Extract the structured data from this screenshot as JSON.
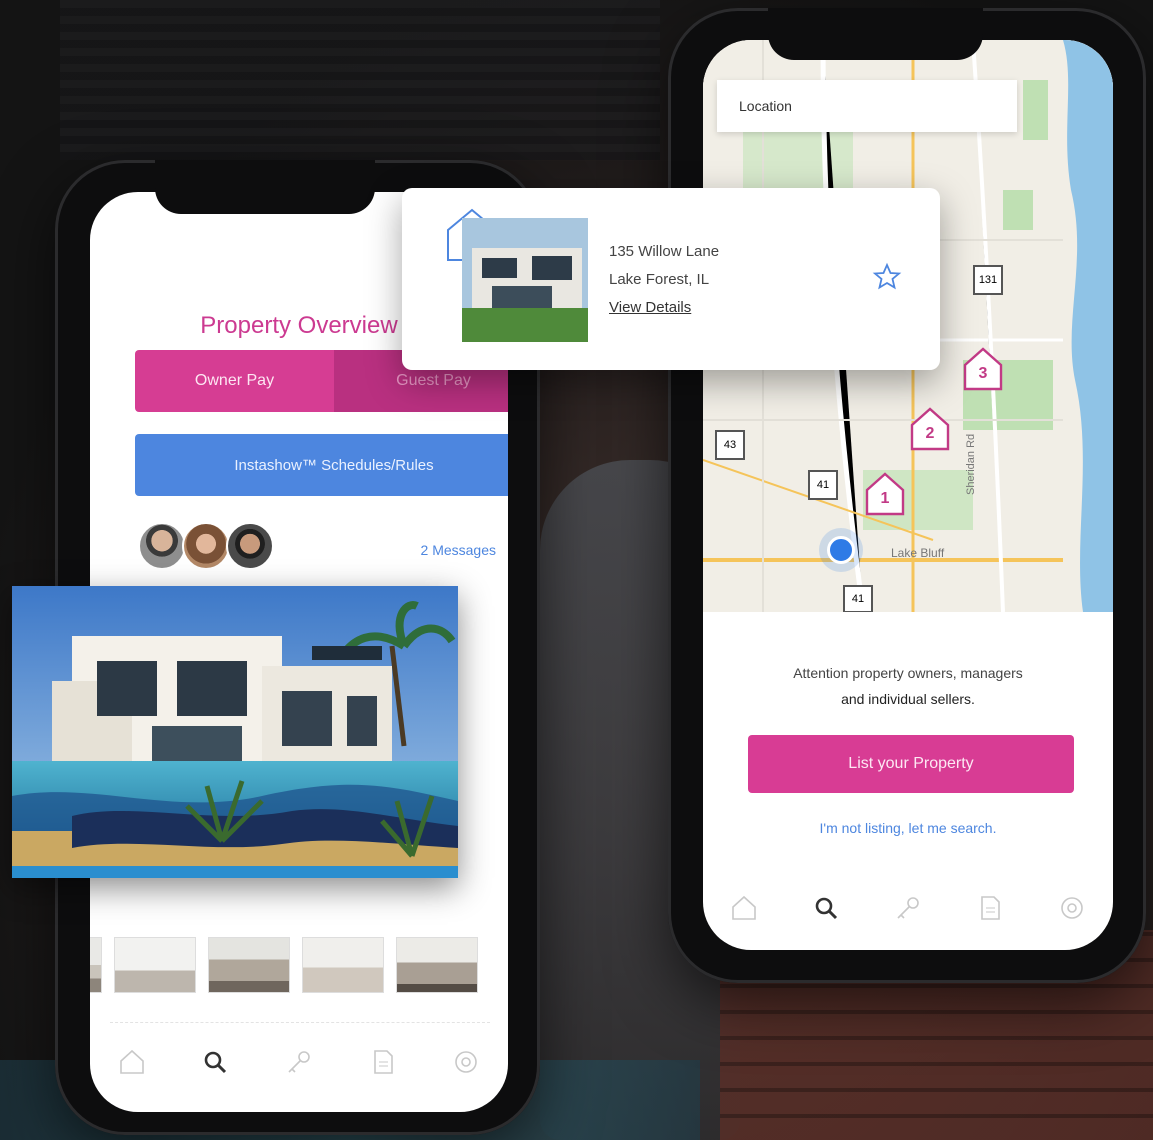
{
  "left_screen": {
    "title": "Property Overview",
    "pay_options": [
      "Owner Pay",
      "Guest Pay"
    ],
    "schedule_button": "Instashow™ Schedules/Rules",
    "messages_link": "2 Messages",
    "tabs": [
      "home-icon",
      "search-icon",
      "key-icon",
      "document-icon",
      "settings-icon"
    ]
  },
  "listing_card": {
    "address_line1": "135 Willow Lane",
    "address_line2": "Lake Forest, IL",
    "view_details": "View Details"
  },
  "right_screen": {
    "location_placeholder": "Location",
    "map_markers": [
      "1",
      "2",
      "3"
    ],
    "map_labels": {
      "highway_41_a": "41",
      "highway_41_b": "41",
      "highway_43": "43",
      "highway_131": "131",
      "route_1": "131",
      "city": "Lake Bluff",
      "road": "Sheridan Rd"
    },
    "attention_line1": "Attention property owners, managers",
    "attention_line2": "and individual sellers.",
    "list_button": "List your Property",
    "not_listing_link": "I'm not listing, let me search.",
    "tabs": [
      "home-icon",
      "search-icon",
      "key-icon",
      "document-icon",
      "settings-icon"
    ]
  },
  "colors": {
    "brand_pink": "#d63d93",
    "brand_blue": "#4d86df",
    "map_marker": "#c23a86"
  }
}
